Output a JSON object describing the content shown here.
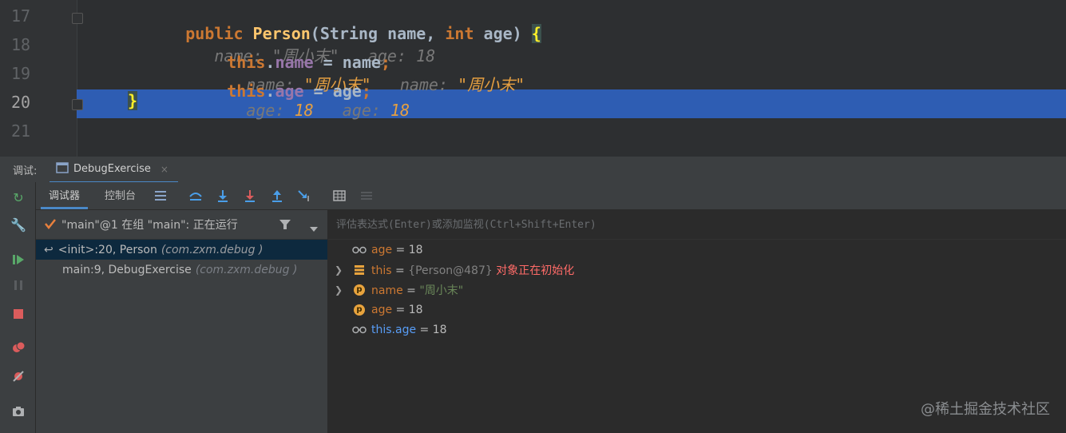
{
  "editor": {
    "lines": [
      {
        "num": "17",
        "tokens": {
          "kw": "public ",
          "type": "Person",
          "sig": "(String name, ",
          "kw2": "int ",
          "rest": "age) ",
          "brace": "{"
        },
        "hints": {
          "a_label": "name: ",
          "a_val": "\"周小末\"",
          "b_label": "age: ",
          "b_val": "18"
        }
      },
      {
        "num": "18",
        "tokens": {
          "this": "this",
          "dot": ".",
          "field": "name",
          "rest": " = name",
          "semi": ";"
        },
        "hints": {
          "a_label": "name: ",
          "a_val": "\"周小末\"",
          "b_label": "name: ",
          "b_val": "\"周小末\""
        }
      },
      {
        "num": "19",
        "tokens": {
          "this": "this",
          "dot": ".",
          "field": "age",
          "rest": " = age",
          "semi": ";"
        },
        "hints": {
          "a_label": "age: ",
          "a_val": "18",
          "b_label": "age: ",
          "b_val": "18"
        }
      },
      {
        "num": "20",
        "tokens": {
          "brace": "}"
        }
      },
      {
        "num": "21"
      }
    ]
  },
  "debug_bar": {
    "label": "调试:",
    "tab": "DebugExercise",
    "close": "×"
  },
  "toolbar": {
    "tab_debugger": "调试器",
    "tab_console": "控制台"
  },
  "frames": {
    "thread": "\"main\"@1 在组 \"main\": 正在运行",
    "items": [
      {
        "method": "<init>:20, Person",
        "pkg": "(com.zxm.debug )"
      },
      {
        "method": "main:9, DebugExercise",
        "pkg": "(com.zxm.debug )"
      }
    ]
  },
  "variables": {
    "eval_placeholder": "评估表达式(Enter)或添加监视(Ctrl+Shift+Enter)",
    "items": [
      {
        "name": "age",
        "eq": " = ",
        "value": "18"
      },
      {
        "name": "this",
        "eq": " = ",
        "value": "{Person@487}",
        "note": " 对象正在初始化"
      },
      {
        "name": "name",
        "eq": " = ",
        "value": "\"周小末\""
      },
      {
        "name": "age",
        "eq": " = ",
        "value": "18"
      },
      {
        "name": "this.age",
        "eq": " = ",
        "value": "18"
      }
    ]
  },
  "watermark": "@稀土掘金技术社区",
  "colors": {
    "accent": "#4a88c7",
    "highlight_line": "#2f65ca",
    "keyword": "#cc7832",
    "method": "#ffc66d",
    "field": "#9876aa",
    "string": "#6a8759",
    "error": "#ff6b68"
  }
}
